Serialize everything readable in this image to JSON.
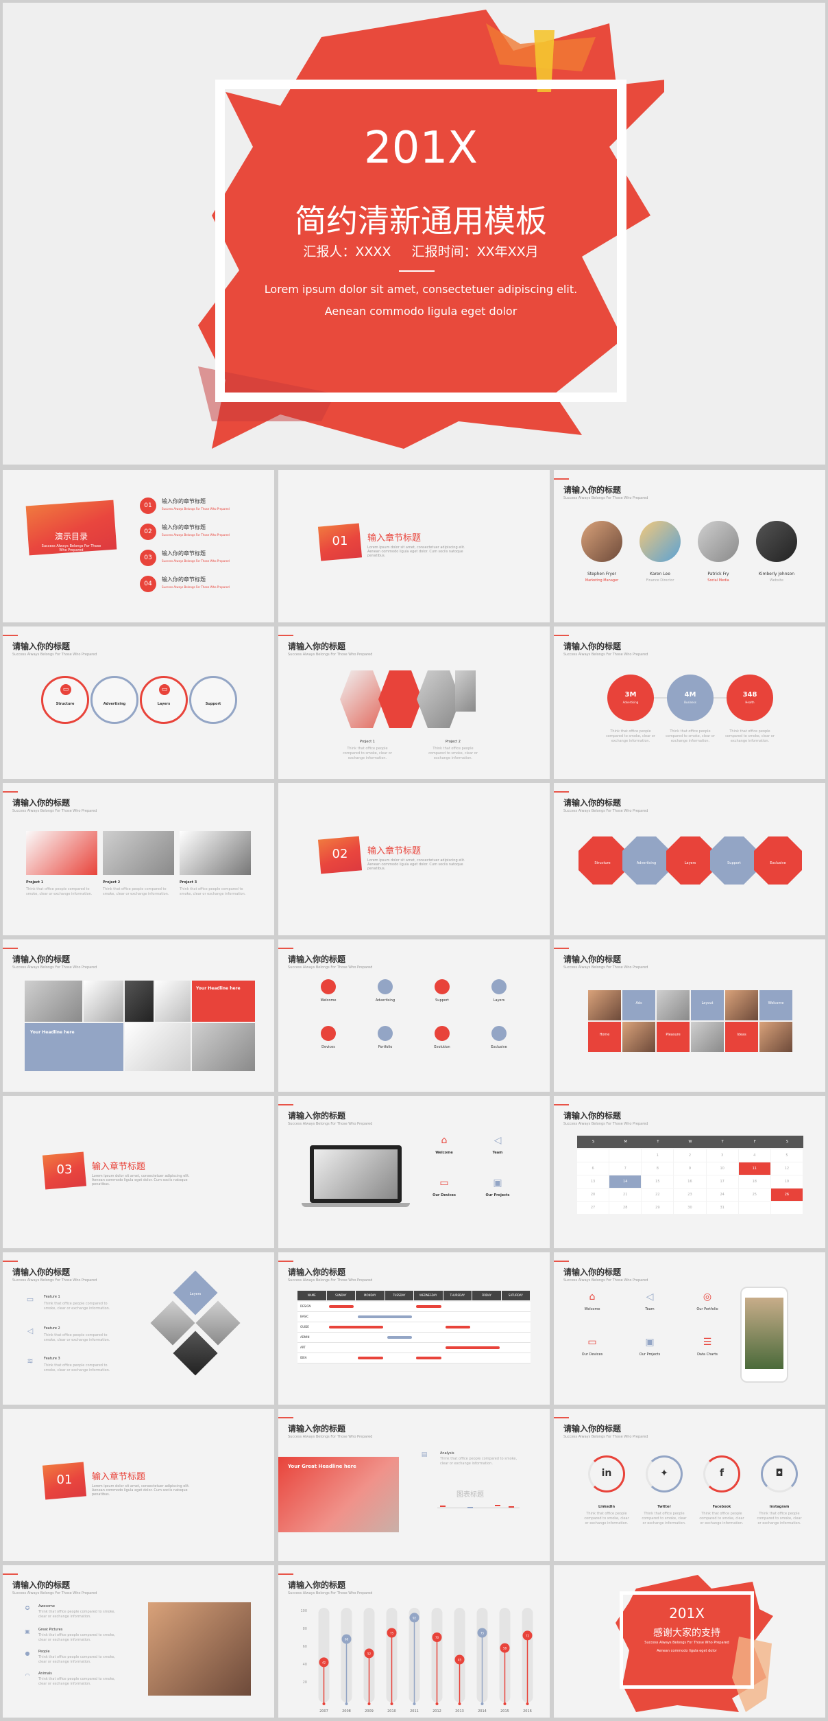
{
  "cover": {
    "year": "201X",
    "title": "简约清新通用模板",
    "reporter": "汇报人：XXXX",
    "report_time": "汇报时间：XX年XX月",
    "line1": "Lorem ipsum dolor sit amet, consectetuer adipiscing elit.",
    "line2": "Aenean commodo ligula eget dolor"
  },
  "common": {
    "slide_title": "请输入你的标题",
    "slide_sub": "Success Always Belongs For Those Who Prepared",
    "small_text": "Think that office people compared to smoke, clear or exchange information.",
    "chapter_title": "输入章节标题",
    "chapter_text": "Lorem ipsum dolor sit amet, consectetuer adipiscing elit. Aenean commodo ligula eget dolor. Cum sociis natoque penatibus."
  },
  "toc": {
    "badge": "演示目录",
    "badge_sub": "Success Always Belongs For Those Who Prepared",
    "items": [
      {
        "num": "01",
        "label": "输入你的章节标题",
        "sub": "Success Always Belongs For Those Who Prepared"
      },
      {
        "num": "02",
        "label": "输入你的章节标题",
        "sub": "Success Always Belongs For Those Who Prepared"
      },
      {
        "num": "03",
        "label": "输入你的章节标题",
        "sub": "Success Always Belongs For Those Who Prepared"
      },
      {
        "num": "04",
        "label": "输入你的章节标题",
        "sub": "Success Always Belongs For Those Who Prepared"
      }
    ]
  },
  "chapters": [
    "01",
    "02",
    "03",
    "01"
  ],
  "team": [
    {
      "name": "Stephen Fryer",
      "role": "Marketing Manager"
    },
    {
      "name": "Karen Lee",
      "role": "Finance Director"
    },
    {
      "name": "Patrick Fry",
      "role": "Social Media"
    },
    {
      "name": "Kimberly Johnson",
      "role": "Website"
    }
  ],
  "circles4": [
    "Structure",
    "Advertising",
    "Layers",
    "Support"
  ],
  "projects2": [
    "Project 1",
    "Project 2"
  ],
  "stats": [
    "3M",
    "4M",
    "348"
  ],
  "stats_sub": [
    "Advertising",
    "Business",
    "Health"
  ],
  "projects3": [
    "Project 1",
    "Project 2",
    "Project 3"
  ],
  "octagons": [
    "Structure",
    "Advertising",
    "Layers",
    "Support",
    "Exclusive"
  ],
  "headline": {
    "a": "Your Headline here",
    "b": "Your Headline here"
  },
  "icon_grid8": [
    "Welcome",
    "Advertising",
    "Support",
    "Layers",
    "Devices",
    "Portfolio",
    "Evolution",
    "Exclusive"
  ],
  "mosaic": [
    "Ads",
    "Layout",
    "Welcome",
    "Home",
    "Pleasure",
    "Ideas"
  ],
  "laptop_items": [
    "Welcome",
    "Team",
    "Our Devices",
    "Our Projects"
  ],
  "calendar": {
    "days": [
      "S",
      "M",
      "T",
      "W",
      "T",
      "F",
      "S"
    ],
    "rows": [
      [
        "",
        "",
        "1",
        "2",
        "3",
        "4",
        "5"
      ],
      [
        "6",
        "7",
        "8",
        "9",
        "10",
        "11",
        "12"
      ],
      [
        "13",
        "14",
        "15",
        "16",
        "17",
        "18",
        "19"
      ],
      [
        "20",
        "21",
        "22",
        "23",
        "24",
        "25",
        "26"
      ],
      [
        "27",
        "28",
        "29",
        "30",
        "31",
        "",
        ""
      ]
    ]
  },
  "features": [
    "Feature 1",
    "Feature 2",
    "Feature 3"
  ],
  "diamond_label": "Layers",
  "gantt": {
    "headers": [
      "NAME",
      "SUNDAY",
      "MONDAY",
      "TUESDAY",
      "WEDNESDAY",
      "THURSDAY",
      "FRIDAY",
      "SATURDAY"
    ],
    "rows": [
      "DESIGN",
      "BASIC",
      "GUIDE",
      "ADMIN",
      "ART",
      "IDEA"
    ]
  },
  "phone_items": [
    "Welcome",
    "Team",
    "Our Portfolio",
    "Our Devices",
    "Our Projects",
    "Data Charts"
  ],
  "headline_block": "Your Great Headline here",
  "analysis_label": "Analysis",
  "chart_label": "图表标题",
  "social": [
    "LinkedIn",
    "Twitter",
    "Facebook",
    "Instagram"
  ],
  "list4": [
    "Awesome",
    "Great Pictures",
    "People",
    "Animals"
  ],
  "chart_data": {
    "type": "bar",
    "categories": [
      "2007",
      "2008",
      "2009",
      "2010",
      "2011",
      "2012",
      "2013",
      "2014",
      "2015",
      "2016"
    ],
    "values": [
      42,
      68,
      52,
      75,
      92,
      70,
      45,
      75,
      58,
      72
    ],
    "yticks": [
      "100",
      "80",
      "60",
      "40",
      "20"
    ],
    "ylim": [
      0,
      100
    ]
  },
  "end": {
    "year": "201X",
    "title": "感谢大家的支持",
    "sub": "Success Always Belongs For Those Who Prepared",
    "sub2": "Aenean commodo ligula eget dolor"
  }
}
